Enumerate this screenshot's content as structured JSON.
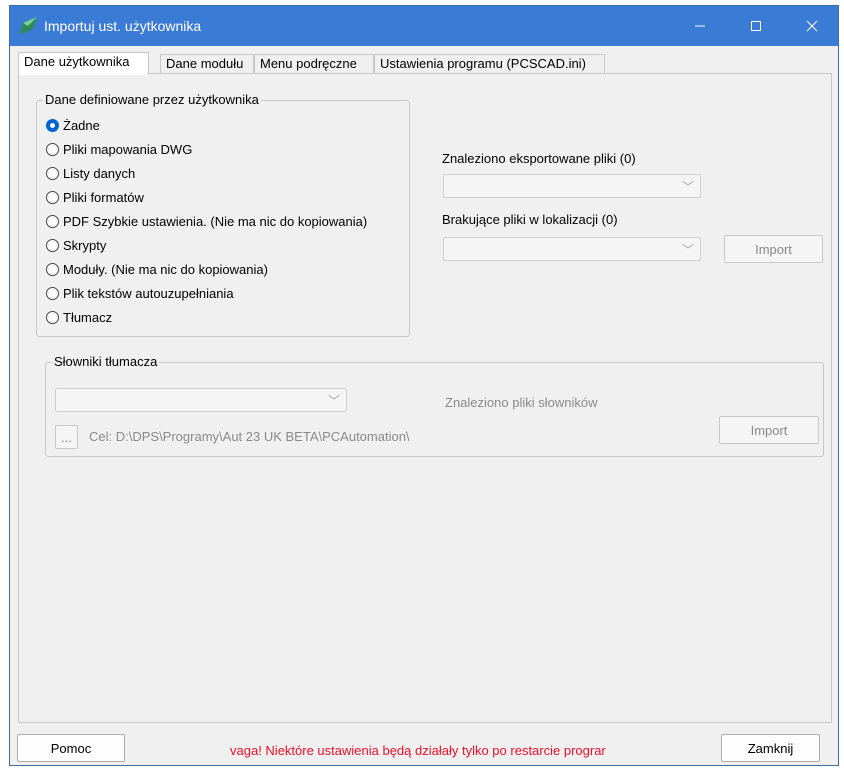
{
  "window": {
    "title": "Importuj ust. użytkownika",
    "controls": {
      "minimize": "—",
      "maximize": "☐",
      "close": "✕"
    }
  },
  "tabs": [
    {
      "label": "Dane użytkownika",
      "active": true
    },
    {
      "label": "Dane modułu",
      "active": false
    },
    {
      "label": "Menu podręczne",
      "active": false
    },
    {
      "label": "Ustawienia programu (PCSCAD.ini)",
      "active": false
    }
  ],
  "user_data_group": {
    "legend": "Dane definiowane przez użytkownika",
    "options": [
      {
        "label": "Żadne",
        "checked": true
      },
      {
        "label": "Pliki mapowania DWG",
        "checked": false
      },
      {
        "label": "Listy danych",
        "checked": false
      },
      {
        "label": "Pliki formatów",
        "checked": false
      },
      {
        "label": "PDF Szybkie ustawienia. (Nie ma nic do kopiowania)",
        "checked": false
      },
      {
        "label": "Skrypty",
        "checked": false
      },
      {
        "label": "Moduły. (Nie ma nic do kopiowania)",
        "checked": false
      },
      {
        "label": "Plik tekstów autouzupełniania",
        "checked": false
      },
      {
        "label": "Tłumacz",
        "checked": false
      }
    ]
  },
  "exported": {
    "found_label": "Znaleziono eksportowane pliki (0)",
    "missing_label": "Brakujące pliki w lokalizacji (0)",
    "import_label": "Import"
  },
  "dictionaries": {
    "legend": "Słowniki tłumacza",
    "found_label": "Znaleziono pliki słowników",
    "browse_label": "...",
    "target_path": "Cel: D:\\DPS\\Programy\\Aut 23 UK BETA\\PCAutomation\\",
    "import_label": "Import"
  },
  "footer": {
    "help_label": "Pomoc",
    "warning": "vaga! Niektóre ustawienia będą działały tylko po restarcie prograr",
    "close_label": "Zamknij"
  },
  "colors": {
    "titlebar": "#3a7bd5",
    "warning": "#e8102a",
    "radio_checked": "#0064d2"
  }
}
